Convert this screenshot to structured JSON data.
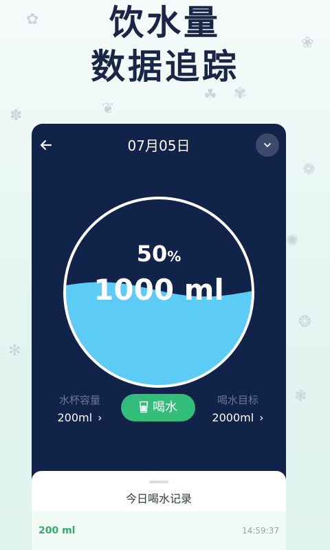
{
  "promo": {
    "line1": "饮水量",
    "line2": "数据追踪"
  },
  "header": {
    "date": "07月05日",
    "back_icon": "arrow-left-icon",
    "dropdown_icon": "chevron-down-icon"
  },
  "gauge": {
    "percent": "50",
    "percent_unit": "%",
    "amount": "1000 ml",
    "fill_fraction": 0.5,
    "water_color": "#5ccbf5",
    "ring_color": "#ffffff"
  },
  "cup_capacity": {
    "label": "水杯容量",
    "value": "200ml",
    "chevron": "›"
  },
  "drink_button": {
    "label": "喝水",
    "icon": "water-cup-icon",
    "color": "#33bd7a"
  },
  "goal": {
    "label": "喝水目标",
    "value": "2000ml",
    "chevron": "›"
  },
  "records": {
    "title": "今日喝水记录",
    "items": [
      {
        "amount": "200 ml",
        "time": "14:59:37"
      }
    ]
  },
  "colors": {
    "card_bg": "#112349",
    "headline": "#1b2647",
    "accent_green": "#33bd7a"
  }
}
